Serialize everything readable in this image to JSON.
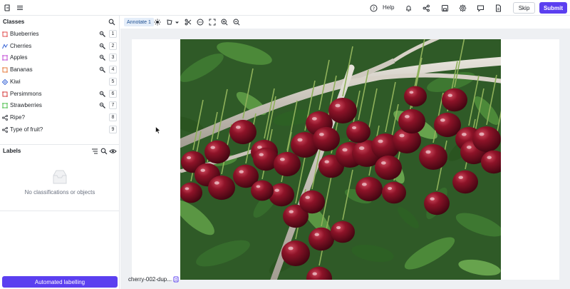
{
  "topbar": {
    "help_label": "Help",
    "skip_label": "Skip",
    "submit_label": "Submit",
    "icons": [
      "sidebar-toggle-icon",
      "menu-icon",
      "help-icon",
      "bell-icon",
      "share-icon",
      "save-icon",
      "settings-icon",
      "chat-icon",
      "document-icon"
    ]
  },
  "classes": {
    "title": "Classes",
    "items": [
      {
        "label": "Blueberries",
        "key": "1",
        "color": "#e24b4b",
        "icon": "bounding-box-icon",
        "tool": true
      },
      {
        "label": "Cherries",
        "key": "2",
        "color": "#3a66d6",
        "icon": "polyline-icon",
        "tool": true
      },
      {
        "label": "Apples",
        "key": "3",
        "color": "#c04bd6",
        "icon": "polygon-icon",
        "tool": true
      },
      {
        "label": "Bananas",
        "key": "4",
        "color": "#e5783a",
        "icon": "bounding-box-icon",
        "tool": true
      },
      {
        "label": "Kiwi",
        "key": "5",
        "color": "#3a66d6",
        "icon": "keypoint-icon",
        "tool": false
      },
      {
        "label": "Persimmons",
        "key": "6",
        "color": "#d63a3a",
        "icon": "bounding-box-icon",
        "tool": true
      },
      {
        "label": "Strawberries",
        "key": "7",
        "color": "#4bbf4b",
        "icon": "polygon-icon",
        "tool": true
      },
      {
        "label": "Ripe?",
        "key": "8",
        "color": "#2b2f36",
        "icon": "classification-icon",
        "tool": false
      },
      {
        "label": "Type of fruit?",
        "key": "9",
        "color": "#2b2f36",
        "icon": "classification-icon",
        "tool": false
      }
    ]
  },
  "labels": {
    "title": "Labels",
    "empty_text": "No classifications or objects"
  },
  "automated_button": "Automated labelling",
  "toolbar": {
    "annotate_label": "Annotate 1"
  },
  "file": {
    "name": "cherry-002-dup..."
  },
  "colors": {
    "accent": "#5b3ff0",
    "chip_bg": "#e4edf9"
  }
}
